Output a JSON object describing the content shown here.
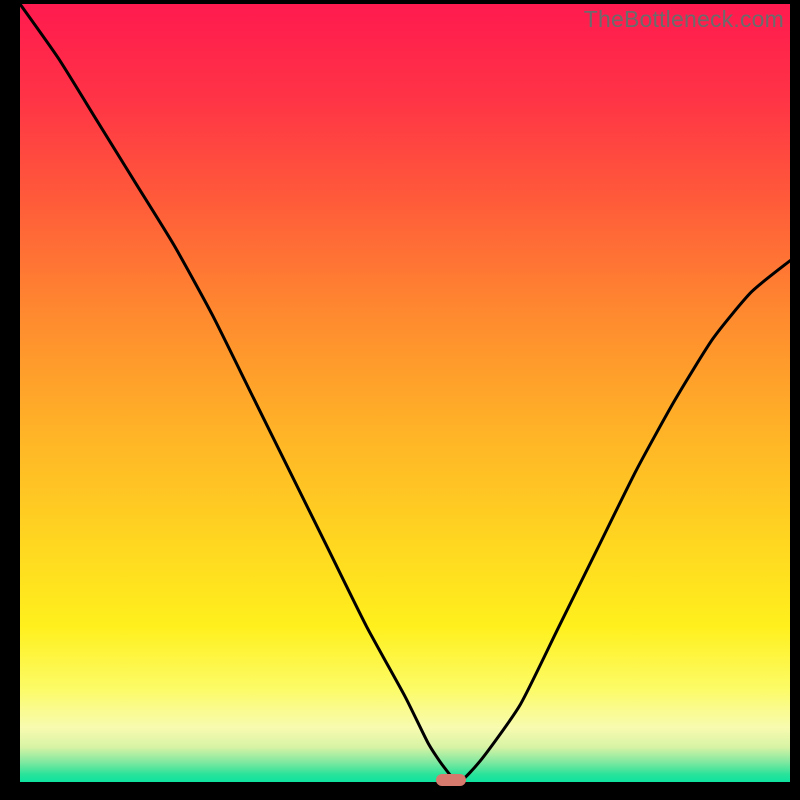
{
  "watermark": "TheBottleneck.com",
  "chart_data": {
    "type": "line",
    "title": "",
    "xlabel": "",
    "ylabel": "",
    "xlim": [
      0,
      100
    ],
    "ylim": [
      0,
      100
    ],
    "x": [
      0,
      5,
      10,
      15,
      20,
      25,
      30,
      35,
      40,
      45,
      50,
      53,
      55,
      57,
      60,
      65,
      70,
      75,
      80,
      85,
      90,
      95,
      100
    ],
    "y": [
      100,
      93,
      85,
      77,
      69,
      60,
      50,
      40,
      30,
      20,
      11,
      5,
      2,
      0,
      3,
      10,
      20,
      30,
      40,
      49,
      57,
      63,
      67
    ],
    "marker_x": 56,
    "marker_y": 0,
    "gradient_stops": [
      {
        "pos": 0.0,
        "color": "#ff1a4f"
      },
      {
        "pos": 0.12,
        "color": "#ff3346"
      },
      {
        "pos": 0.25,
        "color": "#ff5a3a"
      },
      {
        "pos": 0.4,
        "color": "#ff8a2f"
      },
      {
        "pos": 0.55,
        "color": "#ffb327"
      },
      {
        "pos": 0.7,
        "color": "#ffd820"
      },
      {
        "pos": 0.8,
        "color": "#fff01d"
      },
      {
        "pos": 0.88,
        "color": "#fcfb66"
      },
      {
        "pos": 0.93,
        "color": "#f8fbb0"
      },
      {
        "pos": 0.955,
        "color": "#d8f3a5"
      },
      {
        "pos": 0.975,
        "color": "#7ee8a0"
      },
      {
        "pos": 0.99,
        "color": "#2be39a"
      },
      {
        "pos": 1.0,
        "color": "#0de39f"
      }
    ]
  }
}
